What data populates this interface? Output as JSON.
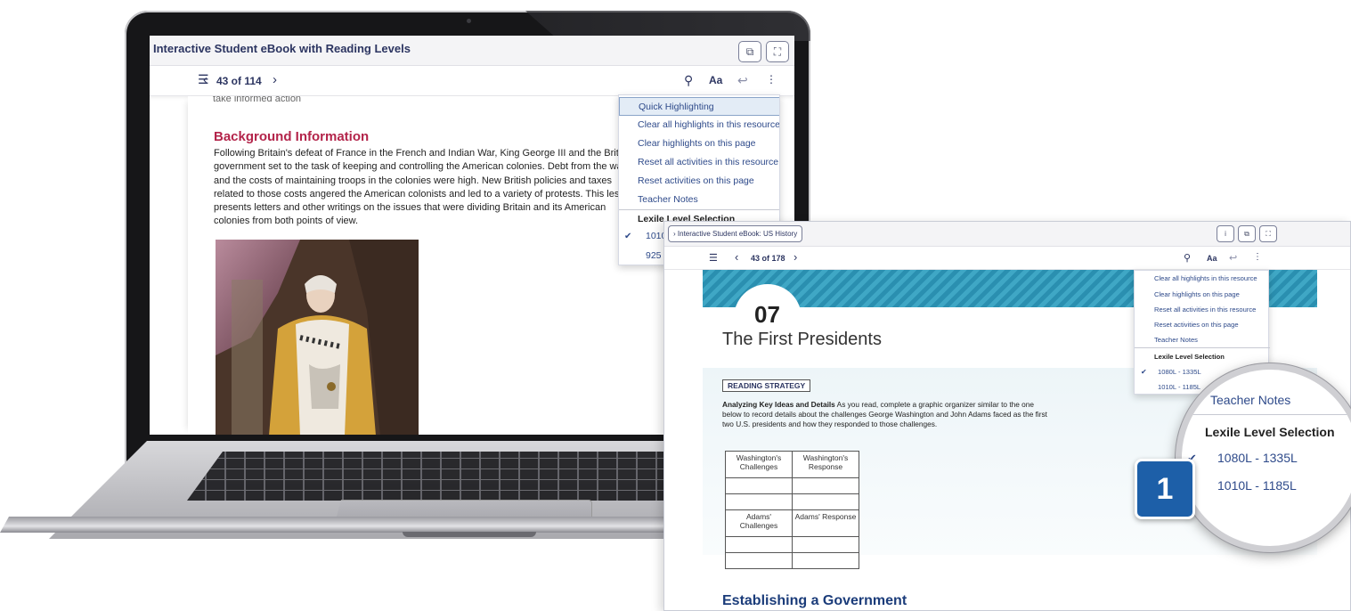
{
  "laptop": {
    "window_title": "Interactive Student eBook with Reading Levels",
    "page_indicator": "43 of 114",
    "aa_label": "Aa",
    "cut_text": "take informed action",
    "heading": "Background Information",
    "paragraph": "Following Britain's defeat of France in the French and Indian War, King George III and the British government set to the task of keeping and controlling the American colonies. Debt from the war and the costs of maintaining troops in the colonies were high. New British policies and taxes related to those costs angered the American colonists and led to a variety of protests. This lesson presents letters and other writings on the issues that were dividing Britain and its American colonies from both points of view.",
    "menu": {
      "items": [
        "Quick Highlighting",
        "Clear all highlights in this resource",
        "Clear highlights on this page",
        "Reset all activities in this resource",
        "Reset activities on this page",
        "Teacher Notes"
      ],
      "section": "Lexile Level Selection",
      "level_1": "1010",
      "level_2": "925"
    }
  },
  "tablet": {
    "window_title": "Interactive Student eBook: US History",
    "page_indicator": "43 of 178",
    "aa_label": "Aa",
    "chapter_number": "07",
    "chapter_title": "The First Presidents",
    "reading_strategy_label": "READING STRATEGY",
    "strategy_bold": "Analyzing Key Ideas and Details",
    "strategy_text": " As you read, complete a graphic organizer similar to the one below to record details about the challenges George Washington and John Adams faced as the first two U.S. presidents and how they responded to those challenges.",
    "organizer": {
      "washington_challenges": "Washington's Challenges",
      "washington_response": "Washington's Response",
      "adams_challenges": "Adams' Challenges",
      "adams_response": "Adams' Response"
    },
    "section_heading": "Establishing a Government",
    "menu": {
      "items": [
        "Clear all highlights in this resource",
        "Clear highlights on this page",
        "Reset all activities in this resource",
        "Reset activities on this page",
        "Teacher Notes"
      ],
      "section": "Lexile Level Selection",
      "level_1": "1080L - 1335L",
      "level_2": "1010L - 1185L"
    }
  },
  "magnifier": {
    "teacher_notes": "Teacher Notes",
    "section": "Lexile Level Selection",
    "level_1": "1080L - 1335L",
    "level_2": "1010L - 1185L"
  },
  "callout_number": "1",
  "icons": [
    "toc-list-icon",
    "chevron-left-icon",
    "chevron-right-icon",
    "search-icon",
    "back-arrow-icon",
    "kebab-menu-icon",
    "external-link-icon",
    "fullscreen-icon",
    "check-icon",
    "info-icon"
  ],
  "colors": {
    "heading_red": "#b3244a",
    "nav_navy": "#2c3561",
    "menu_blue": "#2e4a8a",
    "section_blue": "#1b3c7a",
    "stripe_teal": "#2a8fb0",
    "callout_blue": "#1d5fa8"
  }
}
